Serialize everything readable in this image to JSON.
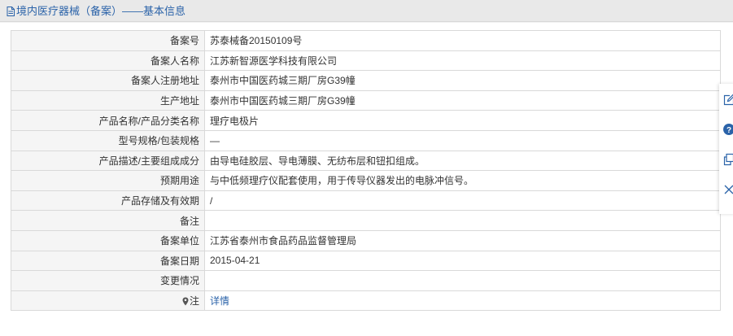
{
  "header": {
    "title": "境内医疗器械（备案）——基本信息",
    "icon": "document-icon"
  },
  "table": {
    "rows": [
      {
        "label": "备案号",
        "value": "苏泰械备20150109号"
      },
      {
        "label": "备案人名称",
        "value": "江苏新智源医学科技有限公司"
      },
      {
        "label": "备案人注册地址",
        "value": "泰州市中国医药城三期厂房G39幢"
      },
      {
        "label": "生产地址",
        "value": "泰州市中国医药城三期厂房G39幢"
      },
      {
        "label": "产品名称/产品分类名称",
        "value": "理疗电极片"
      },
      {
        "label": "型号规格/包装规格",
        "value": "—"
      },
      {
        "label": "产品描述/主要组成成分",
        "value": "由导电硅胶层、导电薄膜、无纺布层和钮扣组成。"
      },
      {
        "label": "预期用途",
        "value": "与中低频理疗仪配套使用，用于传导仪器发出的电脉冲信号。"
      },
      {
        "label": "产品存储及有效期",
        "value": "/"
      },
      {
        "label": "备注",
        "value": ""
      },
      {
        "label": "备案单位",
        "value": "江苏省泰州市食品药品监督管理局"
      },
      {
        "label": "备案日期",
        "value": "2015-04-21"
      },
      {
        "label": "变更情况",
        "value": ""
      }
    ],
    "note": {
      "label": "注",
      "link": "详情",
      "icon": "pin-icon"
    }
  },
  "side_toolbar": {
    "icons": [
      "edit-icon",
      "help-icon",
      "copy-icon",
      "close-icon"
    ]
  },
  "colors": {
    "accent": "#2b63a9",
    "label_bg": "#f5f5f5",
    "border": "#d9d9d9"
  }
}
